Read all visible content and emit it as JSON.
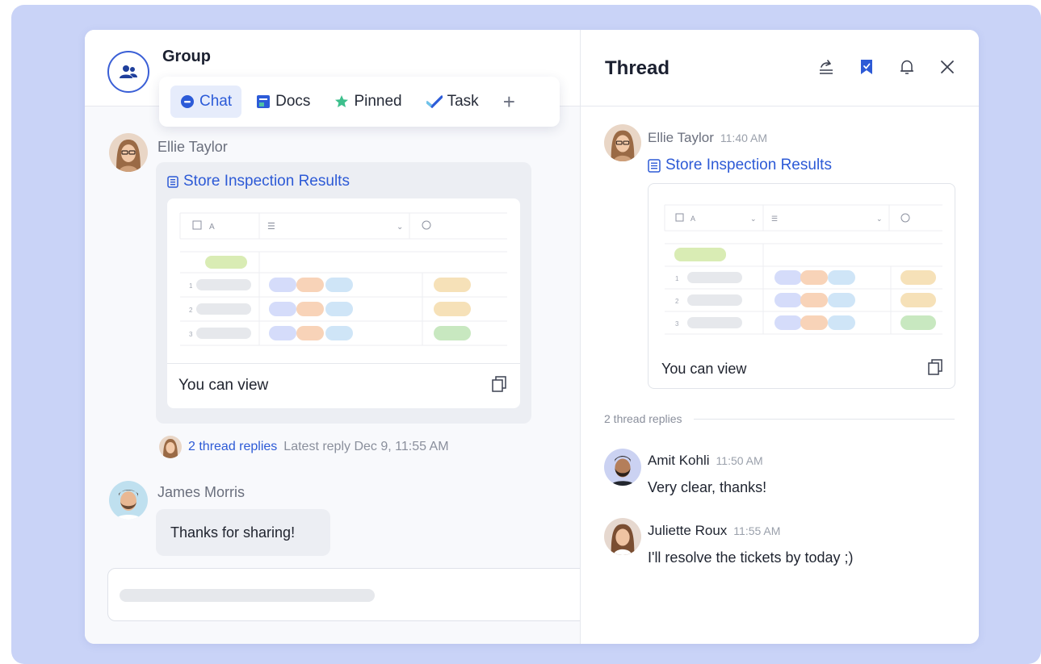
{
  "colors": {
    "accent": "#2d5ad6",
    "backdrop": "#c9d3f7",
    "pill_green": "#d9ecb4",
    "pill_blue": "#d5dcfa",
    "pill_orange": "#f8d3b8",
    "pill_cyan": "#cfe5f7",
    "pill_yellow": "#f6e1b8",
    "pill_green2": "#c8e8c0"
  },
  "group": {
    "title": "Group",
    "avatar_icon": "users-icon"
  },
  "tabs": [
    {
      "label": "Chat",
      "icon": "chat-bubble-icon"
    },
    {
      "label": "Docs",
      "icon": "docs-icon"
    },
    {
      "label": "Pinned",
      "icon": "pin-icon"
    },
    {
      "label": "Task",
      "icon": "check-task-icon"
    },
    {
      "label": "+",
      "icon": "add-icon"
    }
  ],
  "chat": {
    "message1": {
      "author": "Ellie Taylor",
      "doc_title": "Store Inspection Results",
      "doc_footer": "You can view",
      "replies_count": "2 thread replies",
      "replies_latest": "Latest reply Dec 9, 11:55 AM"
    },
    "message2": {
      "author": "James Morris",
      "text": "Thanks for sharing!"
    },
    "table_rows": [
      "1",
      "2",
      "3"
    ]
  },
  "thread": {
    "title": "Thread",
    "header_icons": [
      "share-icon",
      "bookmark-icon",
      "bell-icon",
      "close-icon"
    ],
    "root": {
      "author": "Ellie Taylor",
      "time": "11:40 AM",
      "doc_title": "Store Inspection Results",
      "doc_footer": "You can view"
    },
    "replies_divider": "2 thread replies",
    "replies": [
      {
        "author": "Amit Kohli",
        "time": "11:50 AM",
        "text": "Very clear, thanks!"
      },
      {
        "author": "Juliette Roux",
        "time": "11:55 AM",
        "text": "I'll resolve the tickets by today ;)"
      }
    ],
    "table_rows": [
      "1",
      "2",
      "3"
    ]
  }
}
